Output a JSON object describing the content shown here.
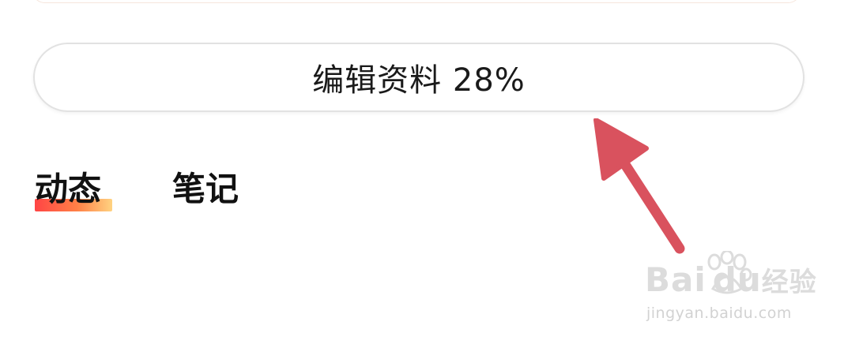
{
  "profile": {
    "edit_button_label": "编辑资料 28%"
  },
  "tabs": [
    {
      "label": "动态",
      "active": true
    },
    {
      "label": "笔记",
      "active": false
    }
  ],
  "watermark": {
    "brand": "Bai",
    "brand_suffix": "du",
    "brand_cn": "经验",
    "url": "jingyan.baidu.com"
  },
  "colors": {
    "arrow": "#d9525e",
    "tab_indicator_start": "#ff3b3b",
    "tab_indicator_end": "#ffd07a",
    "button_border": "#e2e2e2"
  }
}
